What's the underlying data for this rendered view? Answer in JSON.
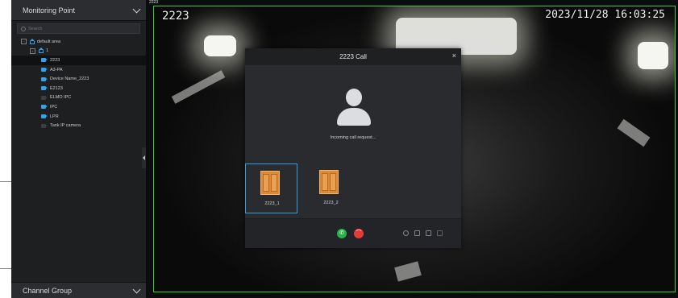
{
  "sidebar": {
    "header": "Monitoring Point",
    "search_placeholder": "Search",
    "area_toggle": "−",
    "area": "default area",
    "group_toggle": "+",
    "group": "1",
    "items": [
      {
        "label": "2223",
        "online": true,
        "selected": true
      },
      {
        "label": "A3-PA",
        "online": true
      },
      {
        "label": "Device Name_2223",
        "online": true
      },
      {
        "label": "E2123",
        "online": true
      },
      {
        "label": "ELMO IPC",
        "online": false
      },
      {
        "label": "IPC",
        "online": true
      },
      {
        "label": "LPR",
        "online": true
      },
      {
        "label": "Tank IP camera",
        "online": false
      }
    ],
    "footer": "Channel Group"
  },
  "video": {
    "corner_label": "2223",
    "osd_name": "2223",
    "osd_time": "2023/11/28 16:03:25",
    "border_color": "#37d12f"
  },
  "dialog": {
    "title": "2223 Call",
    "close": "×",
    "status": "Incoming call request...",
    "doors": [
      {
        "label": "2223_1",
        "selected": true
      },
      {
        "label": "2223_2",
        "selected": false
      }
    ],
    "accept_color": "#28b14a",
    "reject_color": "#e63a3a"
  }
}
